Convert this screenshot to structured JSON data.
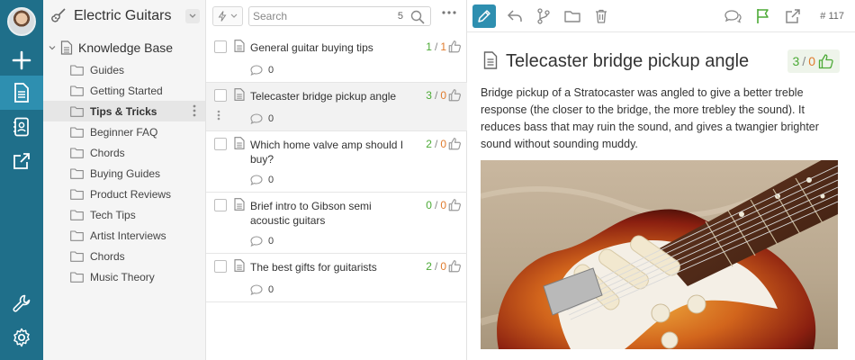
{
  "rail": {
    "items": [
      "avatar",
      "add-icon",
      "document-icon",
      "contacts-icon",
      "external-link-icon",
      "wrench-icon",
      "gear-icon"
    ]
  },
  "tree": {
    "workspace_title": "Electric Guitars",
    "root_label": "Knowledge Base",
    "folders": [
      {
        "label": "Guides"
      },
      {
        "label": "Getting Started"
      },
      {
        "label": "Tips & Tricks",
        "active": true
      },
      {
        "label": "Beginner FAQ"
      },
      {
        "label": "Chords"
      },
      {
        "label": "Buying Guides"
      },
      {
        "label": "Product Reviews"
      },
      {
        "label": "Tech Tips"
      },
      {
        "label": "Artist Interviews"
      },
      {
        "label": "Chords"
      },
      {
        "label": "Music Theory"
      }
    ]
  },
  "list": {
    "search_placeholder": "Search",
    "count": "5",
    "items": [
      {
        "title": "General guitar buying tips",
        "up": "1",
        "down": "1",
        "comments": "0"
      },
      {
        "title": "Telecaster bridge pickup angle",
        "up": "3",
        "down": "0",
        "comments": "0",
        "active": true
      },
      {
        "title": "Which home valve amp should I buy?",
        "up": "2",
        "down": "0",
        "comments": "0"
      },
      {
        "title": "Brief intro to Gibson semi acoustic guitars",
        "up": "0",
        "down": "0",
        "comments": "0"
      },
      {
        "title": "The best gifts for guitarists",
        "up": "2",
        "down": "0",
        "comments": "0"
      }
    ]
  },
  "article": {
    "id": "# 117",
    "title": "Telecaster bridge pickup angle",
    "up": "3",
    "down": "0",
    "body": "Bridge pickup of a Stratocaster was angled to give a better treble response (the closer to the bridge, the more trebley the sound). It reduces bass that may ruin the sound, and gives a twangier brighter sound without sounding muddy."
  },
  "colors": {
    "rail": "#1f6f8a",
    "rail_active": "#2e8fb0",
    "vote_up": "#4caa36",
    "vote_down": "#e07b2d"
  }
}
